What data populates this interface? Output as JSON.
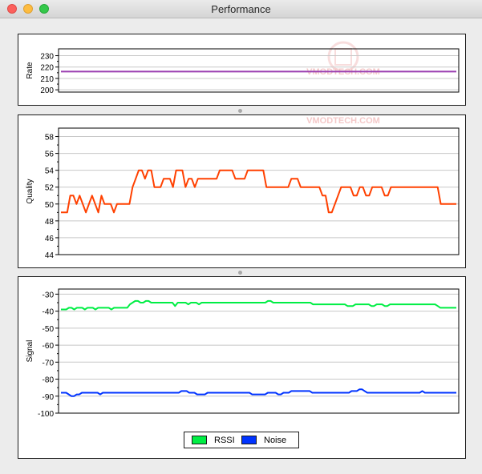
{
  "window": {
    "title": "Performance"
  },
  "watermark": {
    "text": "VMODTECH.COM",
    "color": "#f3c3c3"
  },
  "chart_data": [
    {
      "type": "line",
      "ylabel": "Rate",
      "ylim": [
        198,
        236
      ],
      "yticks": [
        200,
        210,
        220,
        230
      ],
      "series": [
        {
          "color": "#9b3fb1",
          "values": [
            216,
            216,
            216,
            216,
            216,
            216,
            216,
            216,
            216,
            216,
            216,
            216,
            216,
            216,
            216,
            216,
            216,
            216,
            216,
            216,
            216,
            216,
            216,
            216,
            216,
            216,
            216,
            216,
            216,
            216,
            216,
            216,
            216,
            216,
            216,
            216,
            216,
            216,
            216,
            216,
            216,
            216,
            216,
            216,
            216,
            216,
            216,
            216,
            216,
            216,
            216,
            216,
            216,
            216,
            216,
            216,
            216,
            216,
            216,
            216,
            216,
            216,
            216,
            216,
            216,
            216,
            216,
            216,
            216,
            216,
            216,
            216,
            216,
            216,
            216,
            216,
            216,
            216,
            216,
            216,
            216,
            216,
            216,
            216,
            216,
            216,
            216,
            216,
            216,
            216,
            216,
            216,
            216,
            216,
            216,
            216,
            216,
            216,
            216,
            216,
            216,
            216,
            216,
            216,
            216,
            216,
            216,
            216,
            216,
            216,
            216,
            216,
            216,
            216,
            216,
            216,
            216,
            216,
            216,
            216,
            216,
            216,
            216,
            216,
            216,
            216,
            216,
            216,
            216,
            216,
            216,
            216,
            216,
            216,
            216,
            216,
            216,
            216,
            216,
            216,
            216,
            216,
            216,
            216,
            216,
            216,
            216,
            216,
            216,
            216
          ]
        }
      ]
    },
    {
      "type": "line",
      "ylabel": "Quality",
      "ylim": [
        44,
        59
      ],
      "yticks": [
        44,
        46,
        48,
        50,
        52,
        54,
        56,
        58
      ],
      "series": [
        {
          "color": "#ff4000",
          "values": [
            49,
            49,
            49,
            51,
            51,
            50,
            51,
            50,
            49,
            50,
            51,
            50,
            49,
            51,
            50,
            50,
            50,
            49,
            50,
            50,
            50,
            50,
            50,
            52,
            53,
            54,
            54,
            53,
            54,
            54,
            52,
            52,
            52,
            53,
            53,
            53,
            52,
            54,
            54,
            54,
            52,
            53,
            53,
            52,
            53,
            53,
            53,
            53,
            53,
            53,
            53,
            54,
            54,
            54,
            54,
            54,
            53,
            53,
            53,
            53,
            54,
            54,
            54,
            54,
            54,
            54,
            52,
            52,
            52,
            52,
            52,
            52,
            52,
            52,
            53,
            53,
            53,
            52,
            52,
            52,
            52,
            52,
            52,
            52,
            51,
            51,
            49,
            49,
            50,
            51,
            52,
            52,
            52,
            52,
            51,
            51,
            52,
            52,
            51,
            51,
            52,
            52,
            52,
            52,
            51,
            51,
            52,
            52,
            52,
            52,
            52,
            52,
            52,
            52,
            52,
            52,
            52,
            52,
            52,
            52,
            52,
            52,
            50,
            50,
            50,
            50,
            50,
            50
          ]
        }
      ]
    },
    {
      "type": "line",
      "ylabel": "Signal",
      "ylim": [
        -100,
        -27
      ],
      "yticks": [
        -100,
        -90,
        -80,
        -70,
        -60,
        -50,
        -40,
        -30
      ],
      "series": [
        {
          "name": "RSSI",
          "color": "#00ee44",
          "values": [
            -39,
            -39,
            -39,
            -38,
            -38,
            -39,
            -38,
            -38,
            -38,
            -39,
            -38,
            -38,
            -38,
            -39,
            -38,
            -38,
            -38,
            -38,
            -38,
            -39,
            -38,
            -38,
            -38,
            -38,
            -38,
            -38,
            -36,
            -35,
            -34,
            -34,
            -35,
            -35,
            -34,
            -34,
            -35,
            -35,
            -35,
            -35,
            -35,
            -35,
            -35,
            -35,
            -35,
            -37,
            -35,
            -35,
            -35,
            -35,
            -36,
            -35,
            -35,
            -35,
            -36,
            -35,
            -35,
            -35,
            -35,
            -35,
            -35,
            -35,
            -35,
            -35,
            -35,
            -35,
            -35,
            -35,
            -35,
            -35,
            -35,
            -35,
            -35,
            -35,
            -35,
            -35,
            -35,
            -35,
            -35,
            -35,
            -34,
            -34,
            -35,
            -35,
            -35,
            -35,
            -35,
            -35,
            -35,
            -35,
            -35,
            -35,
            -35,
            -35,
            -35,
            -35,
            -35,
            -36,
            -36,
            -36,
            -36,
            -36,
            -36,
            -36,
            -36,
            -36,
            -36,
            -36,
            -36,
            -36,
            -37,
            -37,
            -37,
            -36,
            -36,
            -36,
            -36,
            -36,
            -36,
            -37,
            -37,
            -36,
            -36,
            -36,
            -37,
            -37,
            -36,
            -36,
            -36,
            -36,
            -36,
            -36,
            -36,
            -36,
            -36,
            -36,
            -36,
            -36,
            -36,
            -36,
            -36,
            -36,
            -36,
            -36,
            -37,
            -38,
            -38,
            -38,
            -38,
            -38,
            -38,
            -38
          ]
        },
        {
          "name": "Noise",
          "color": "#0033ff",
          "values": [
            -88,
            -88,
            -88,
            -89,
            -90,
            -90,
            -89,
            -89,
            -88,
            -88,
            -88,
            -88,
            -88,
            -88,
            -88,
            -89,
            -88,
            -88,
            -88,
            -88,
            -88,
            -88,
            -88,
            -88,
            -88,
            -88,
            -88,
            -88,
            -88,
            -88,
            -88,
            -88,
            -88,
            -88,
            -88,
            -88,
            -88,
            -88,
            -88,
            -88,
            -88,
            -88,
            -88,
            -88,
            -88,
            -88,
            -87,
            -87,
            -87,
            -88,
            -88,
            -88,
            -89,
            -89,
            -89,
            -89,
            -88,
            -88,
            -88,
            -88,
            -88,
            -88,
            -88,
            -88,
            -88,
            -88,
            -88,
            -88,
            -88,
            -88,
            -88,
            -88,
            -88,
            -89,
            -89,
            -89,
            -89,
            -89,
            -89,
            -88,
            -88,
            -88,
            -88,
            -89,
            -89,
            -88,
            -88,
            -88,
            -87,
            -87,
            -87,
            -87,
            -87,
            -87,
            -87,
            -87,
            -88,
            -88,
            -88,
            -88,
            -88,
            -88,
            -88,
            -88,
            -88,
            -88,
            -88,
            -88,
            -88,
            -88,
            -88,
            -87,
            -87,
            -87,
            -86,
            -86,
            -87,
            -88,
            -88,
            -88,
            -88,
            -88,
            -88,
            -88,
            -88,
            -88,
            -88,
            -88,
            -88,
            -88,
            -88,
            -88,
            -88,
            -88,
            -88,
            -88,
            -88,
            -88,
            -87,
            -88,
            -88,
            -88,
            -88,
            -88,
            -88,
            -88,
            -88,
            -88,
            -88,
            -88,
            -88,
            -88
          ]
        }
      ],
      "legend": {
        "position": "bottom-center"
      }
    }
  ]
}
